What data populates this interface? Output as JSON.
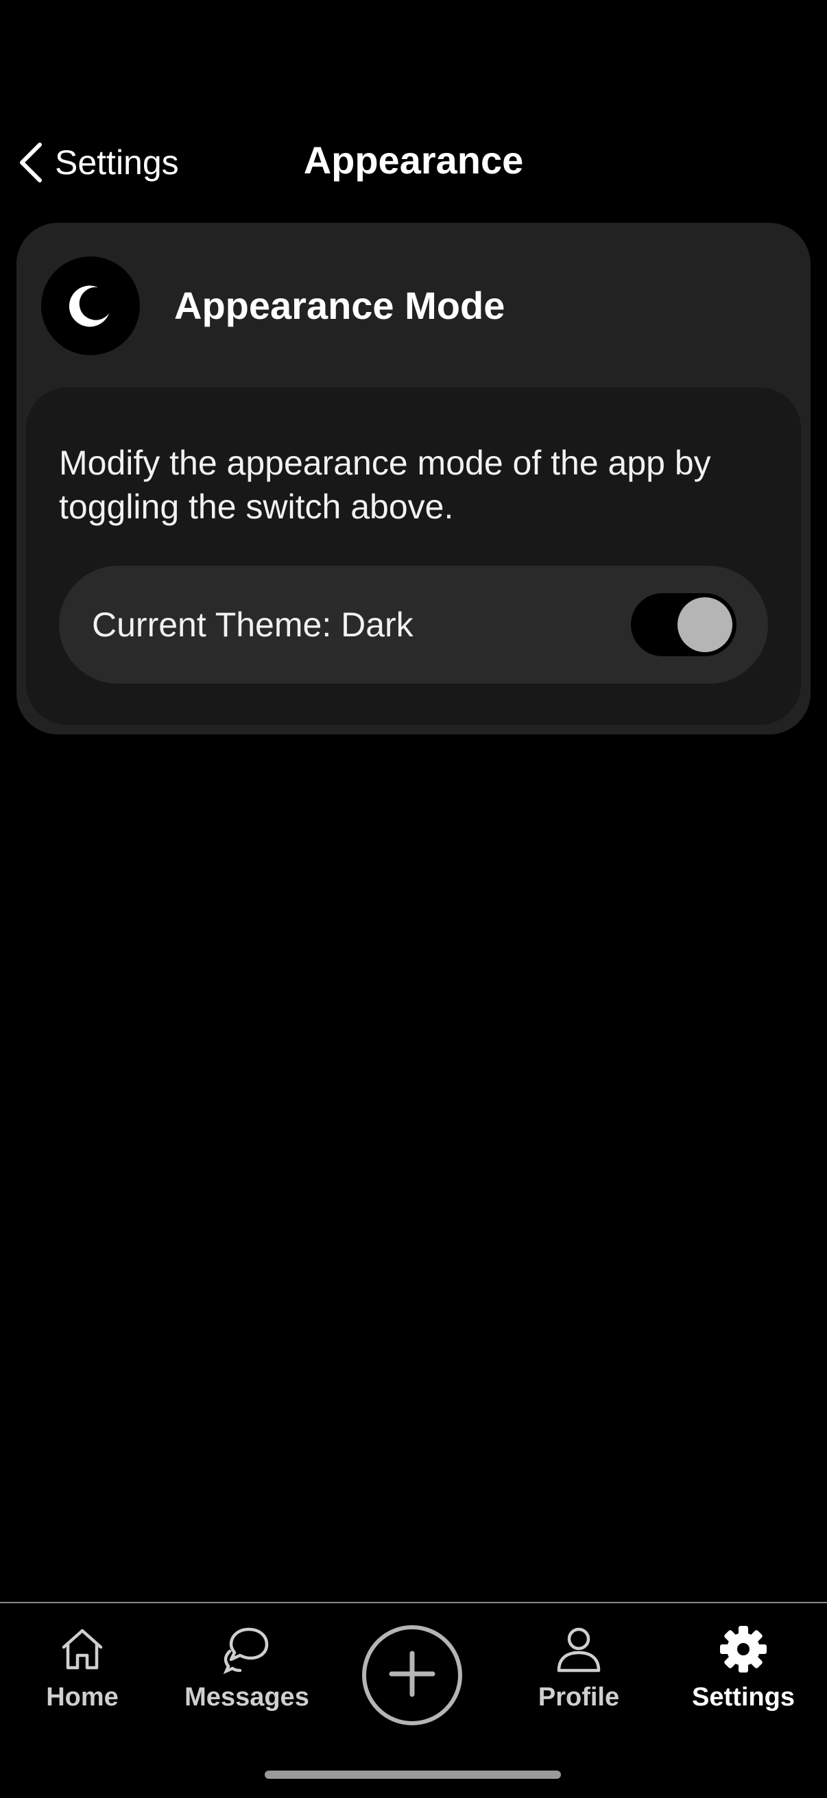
{
  "header": {
    "back_label": "Settings",
    "title": "Appearance"
  },
  "card": {
    "icon": "moon-icon",
    "title": "Appearance Mode",
    "description": "Modify the appearance mode of the app by toggling the switch above.",
    "theme_label": "Current Theme: Dark",
    "toggle_on": true
  },
  "tabbar": {
    "items": [
      {
        "label": "Home",
        "icon": "home-icon",
        "active": false
      },
      {
        "label": "Messages",
        "icon": "chat-bubbles-icon",
        "active": false
      },
      {
        "label": "Profile",
        "icon": "person-icon",
        "active": false
      },
      {
        "label": "Settings",
        "icon": "gear-icon",
        "active": true
      }
    ],
    "add_icon": "plus-circle-icon"
  },
  "colors": {
    "background": "#000000",
    "card": "#222222",
    "inner_card": "#181818",
    "row": "#2a2a2a",
    "knob": "#b5b5b5"
  }
}
